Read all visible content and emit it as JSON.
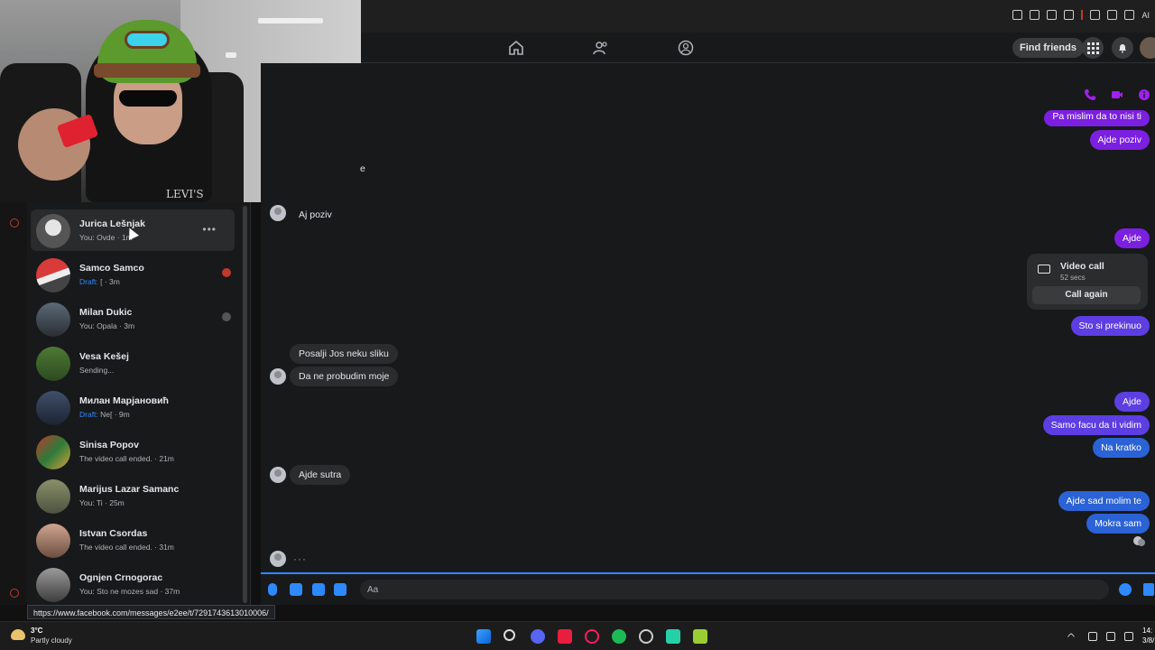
{
  "browser": {
    "ai_label": "AI"
  },
  "nav": {
    "find_friends": "Find friends"
  },
  "webcam": {
    "shirt_text": "LEVI'S"
  },
  "chats": [
    {
      "name": "Jurica Lešnjak",
      "preview": "You: Ovde · 1m",
      "active": true
    },
    {
      "name": "Samco Samco",
      "draft": "Draft:",
      "preview": " [ · 3m"
    },
    {
      "name": "Milan Dukic",
      "preview": "You: Opala · 3m"
    },
    {
      "name": "Vesa Kešej",
      "preview": "Sending..."
    },
    {
      "name": "Милан Марјановић",
      "draft": "Draft:",
      "preview": " Ne[ · 9m"
    },
    {
      "name": "Sinisa Popov",
      "preview": "The video call ended. · 21m"
    },
    {
      "name": "Marijus Lazar Samanc",
      "preview": "You: Ti · 25m"
    },
    {
      "name": "Istvan Csordas",
      "preview": "The video call ended. · 31m"
    },
    {
      "name": "Ognjen Crnogorac",
      "preview": "You: Sto ne mozes sad · 37m"
    }
  ],
  "messages": {
    "out_1": "Pa mislim da to nisi ti",
    "out_2": "Ajde poziv",
    "in_partial": "e",
    "in_1": "Aj poziv",
    "out_3": "Ajde",
    "video_call_title": "Video call",
    "video_call_duration": "52 secs",
    "call_again": "Call again",
    "out_4": "Sto si prekinuo",
    "in_2": "Posalji Jos neku sliku",
    "in_3": "Da ne probudim moje",
    "out_5": "Ajde",
    "out_6": "Samo facu da ti vidim",
    "out_7": "Na kratko",
    "in_4": "Ajde sutra",
    "out_8": "Ajde sad molim te",
    "out_9": "Mokra sam",
    "typing": "···"
  },
  "composer": {
    "placeholder": "Aa"
  },
  "status_url": "https://www.facebook.com/messages/e2ee/t/7291743613010006/",
  "taskbar": {
    "weather_temp": "3°C",
    "weather_desc": "Partly cloudy",
    "time": "14:",
    "date": "3/8/"
  },
  "colors": {
    "accent": "#2e89ff",
    "purple": "#7b1fe0",
    "violet": "#5c3ee3",
    "blue": "#2b62d6"
  }
}
